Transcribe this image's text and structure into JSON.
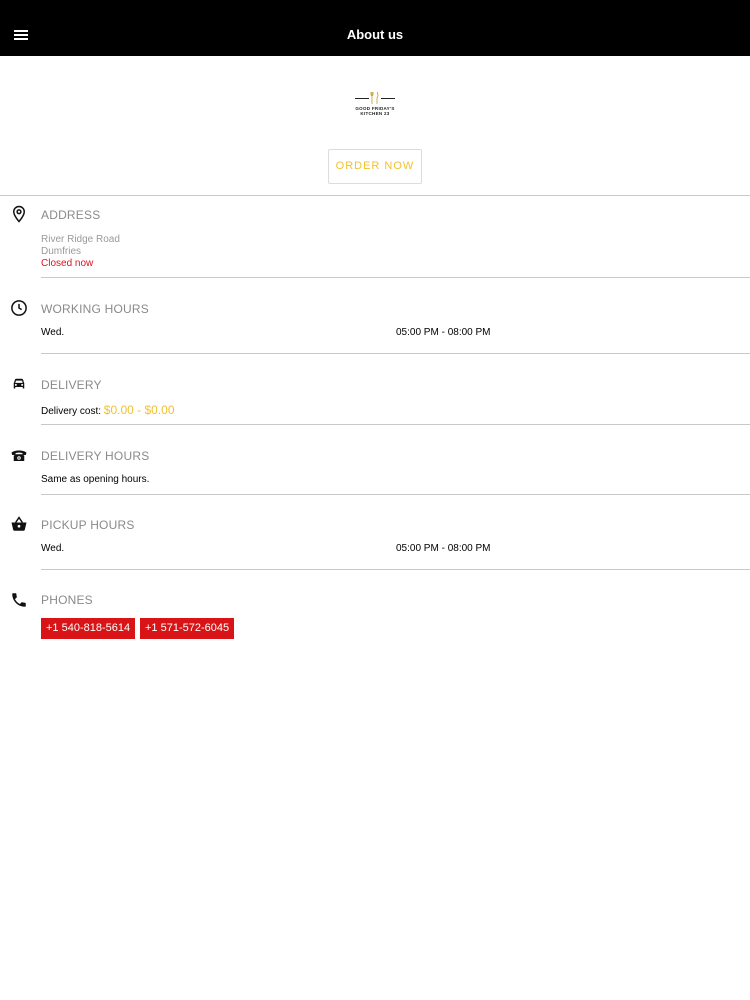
{
  "header": {
    "title": "About us",
    "menu_icon": "hamburger-menu-icon"
  },
  "logo": {
    "line1": "GOOD FRIDAY'S",
    "line2": "KITCHEN 23"
  },
  "order_button": {
    "label": "ORDER NOW"
  },
  "address": {
    "title": "ADDRESS",
    "street": "River Ridge Road",
    "city": "Dumfries",
    "status": "Closed now",
    "icon": "location-pin-icon"
  },
  "working_hours": {
    "title": "WORKING HOURS",
    "day": "Wed.",
    "hours": "05:00 PM - 08:00 PM",
    "icon": "clock-icon"
  },
  "delivery": {
    "title": "DELIVERY",
    "cost_label": "Delivery cost:",
    "cost_value": "$0.00 - $0.00",
    "icon": "car-icon"
  },
  "delivery_hours": {
    "title": "DELIVERY HOURS",
    "text": "Same as opening hours.",
    "icon": "telephone-icon"
  },
  "pickup_hours": {
    "title": "PICKUP HOURS",
    "day": "Wed.",
    "hours": "05:00 PM - 08:00 PM",
    "icon": "basket-icon"
  },
  "phones": {
    "title": "PHONES",
    "numbers": [
      "+1 540-818-5614",
      "+1 571-572-6045"
    ],
    "icon": "phone-icon"
  },
  "colors": {
    "accent_gold": "#f2c12e",
    "danger_red": "#d81416",
    "header_bg": "#000000"
  }
}
